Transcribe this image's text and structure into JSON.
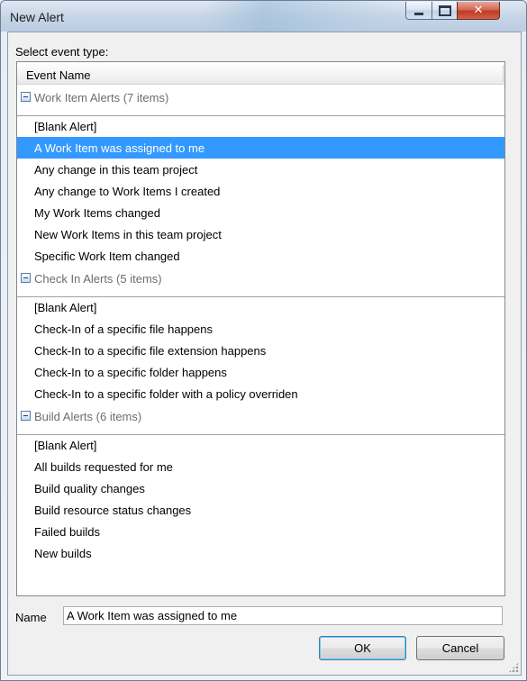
{
  "window": {
    "title": "New Alert",
    "controls": {
      "minimize": "minimize",
      "maximize": "maximize",
      "close": "✕"
    }
  },
  "select_label": "Select event type:",
  "list": {
    "column_header": "Event Name",
    "groups": [
      {
        "label": "Work Item Alerts (7 items)",
        "items": [
          "[Blank Alert]",
          "A Work Item was assigned to me",
          "Any change in this team project",
          "Any change to Work Items I created",
          "My Work Items changed",
          "New Work Items in this team project",
          "Specific Work Item changed"
        ]
      },
      {
        "label": "Check In Alerts (5 items)",
        "items": [
          "[Blank Alert]",
          "Check-In of a specific file happens",
          "Check-In to a specific file extension happens",
          "Check-In to a specific folder happens",
          "Check-In to a specific folder with a policy overriden"
        ]
      },
      {
        "label": "Build Alerts (6 items)",
        "items": [
          "[Blank Alert]",
          "All builds requested for me",
          "Build quality changes",
          "Build resource status changes",
          "Failed builds",
          "New builds"
        ]
      }
    ],
    "selected": "A Work Item was assigned to me",
    "selection_color": "#3399ff"
  },
  "name_field": {
    "label": "Name",
    "value": "A Work Item was assigned to me"
  },
  "buttons": {
    "ok": "OK",
    "cancel": "Cancel"
  }
}
